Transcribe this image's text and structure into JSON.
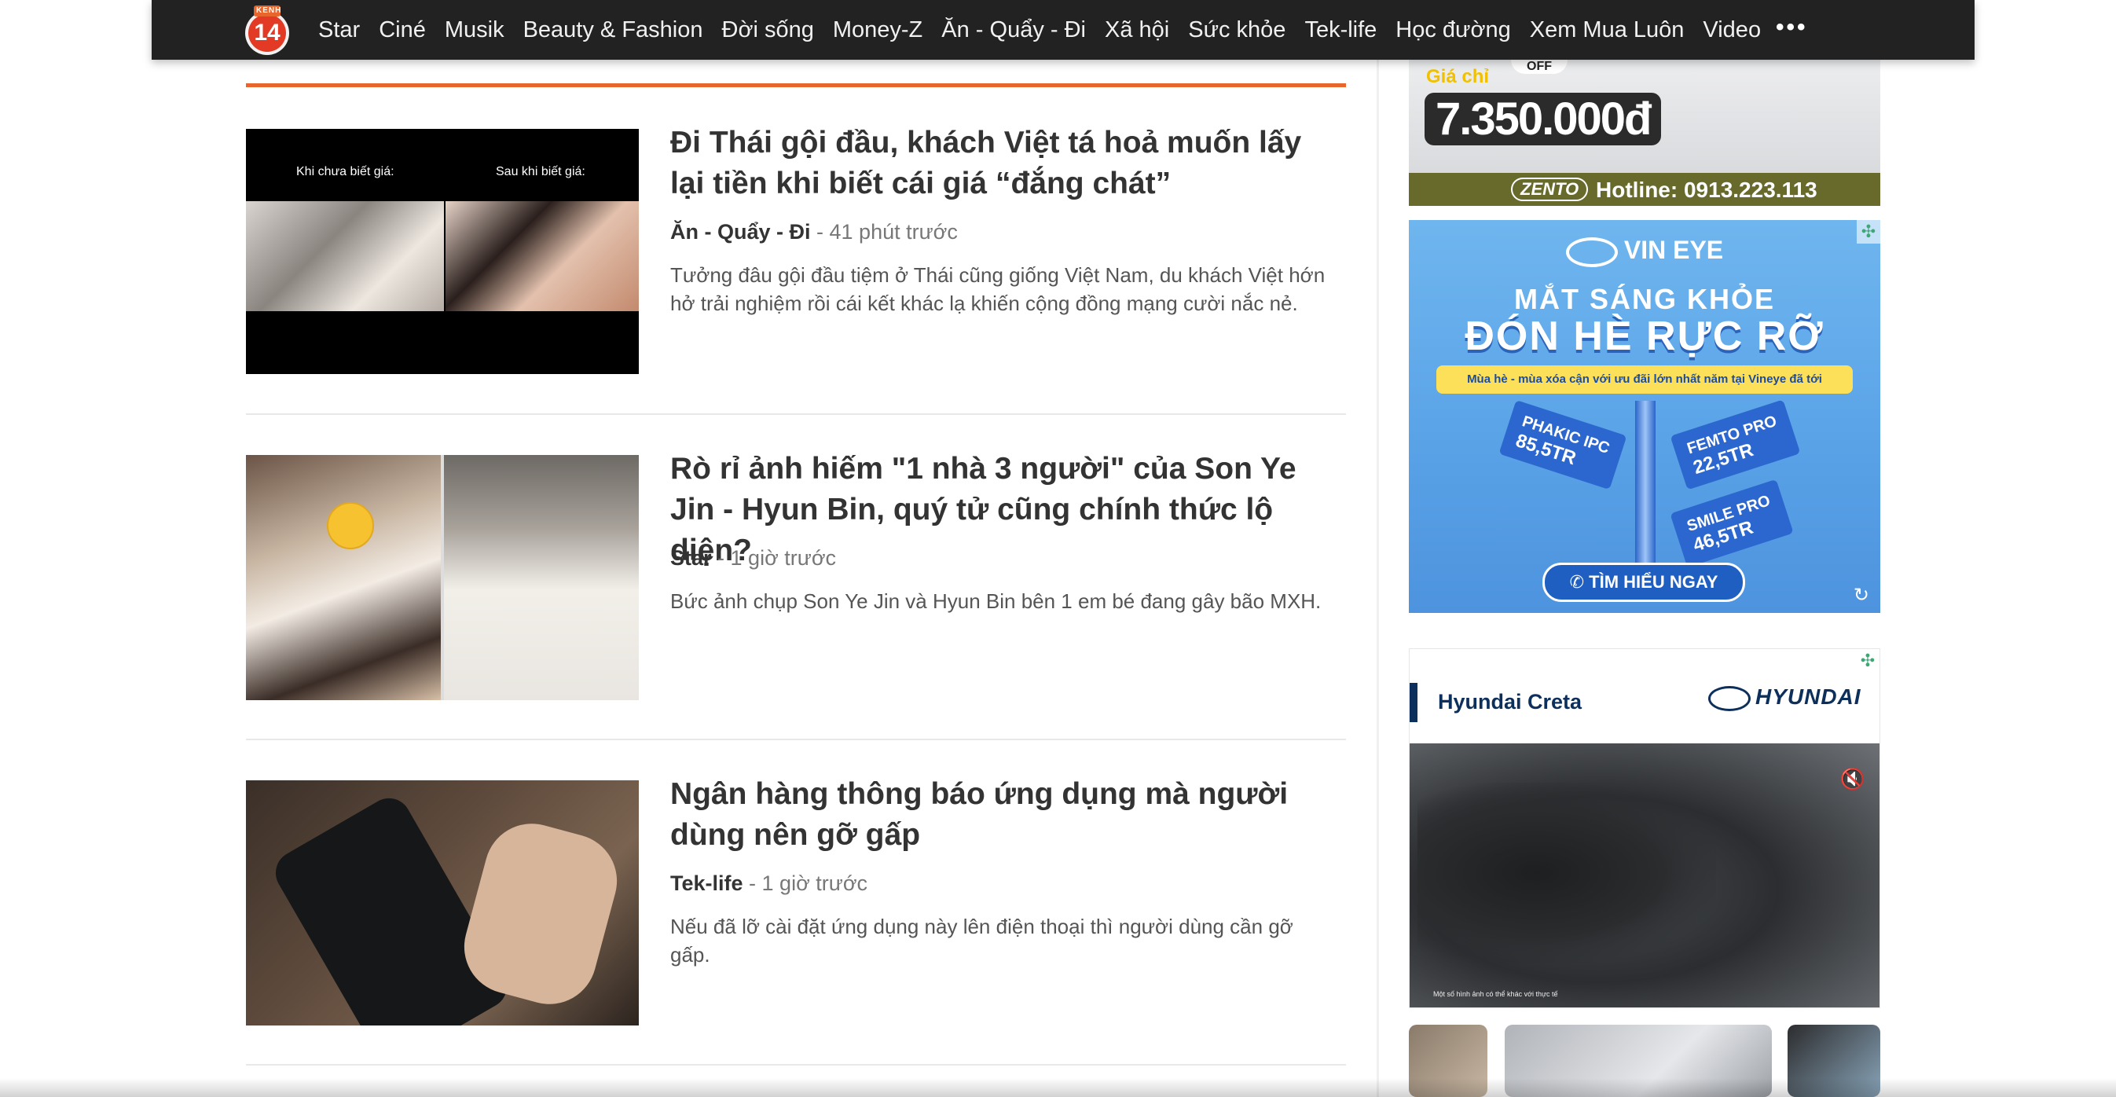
{
  "nav": {
    "logo_top": "KENH",
    "logo_number": "14",
    "items": [
      "Star",
      "Ciné",
      "Musik",
      "Beauty & Fashion",
      "Đời sống",
      "Money-Z",
      "Ăn - Quẩy - Đi",
      "Xã hội",
      "Sức khỏe",
      "Tek-life",
      "Học đường",
      "Xem Mua Luôn",
      "Video"
    ],
    "more": "•••"
  },
  "articles": [
    {
      "title": "Đi Thái gội đầu, khách Việt tá hoả muốn lấy lại tiền khi biết cái giá “đắng chát”",
      "category": "Ăn - Quẩy - Đi",
      "time": "41 phút trước",
      "sapo": "Tưởng đâu gội đầu tiệm ở Thái cũng giống Việt Nam, du khách Việt hớn hở trải nghiệm rồi cái kết khác lạ khiến cộng đồng mạng cười nắc nẻ.",
      "thumb_caption_left": "Khi chưa biết giá:",
      "thumb_caption_right": "Sau khi biết giá:"
    },
    {
      "title": "Rò rỉ ảnh hiếm \"1 nhà 3 người\" của Son Ye Jin - Hyun Bin, quý tử cũng chính thức lộ diện?",
      "category": "Star",
      "time": "1 giờ trước",
      "sapo": "Bức ảnh chụp Son Ye Jin và Hyun Bin bên 1 em bé đang gây bão MXH."
    },
    {
      "title": "Ngân hàng thông báo ứng dụng mà người dùng nên gỡ gấp",
      "category": "Tek-life",
      "time": "1 giờ trước",
      "sapo": "Nếu đã lỡ cài đặt ứng dụng này lên điện thoại thì người dùng cần gỡ gấp."
    }
  ],
  "meta_sep": " - ",
  "ads": {
    "zento": {
      "off": "OFF",
      "price_label": "Giá chỉ",
      "price": "7.350.000đ",
      "brand": "ZENTO",
      "hotline": "Hotline: 0913.223.113"
    },
    "vineye": {
      "brand": "VIN EYE",
      "headline1": "MẮT SÁNG KHỎE",
      "headline2": "ĐÓN HÈ RỰC RỠ",
      "strip": "Mùa hè - mùa xóa cận với ưu đãi lớn nhất năm tại Vineye đã tới",
      "sign1_name": "PHAKIC IPC",
      "sign1_price": "85,5TR",
      "sign2_name": "FEMTO PRO",
      "sign2_price": "22,5TR",
      "sign3_name": "SMILE PRO",
      "sign3_price": "46,5TR",
      "cta": "TÌM HIỂU NGAY"
    },
    "hyundai": {
      "label": "Hyundai Creta",
      "brand": "HYUNDAI",
      "caption": "Một số hình ảnh có thể khác với thực tế"
    }
  },
  "colors": {
    "nav_bg": "#222222",
    "accent_orange": "#e8662c",
    "logo_red": "#e23a25",
    "hyundai_navy": "#0d2f5b"
  }
}
